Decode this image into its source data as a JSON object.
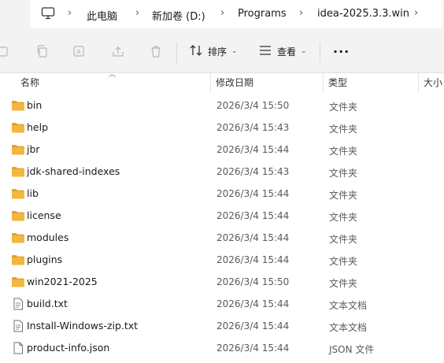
{
  "breadcrumb": [
    "此电脑",
    "新加卷 (D:)",
    "Programs",
    "idea-2025.3.3.win"
  ],
  "toolbar": {
    "sort_label": "排序",
    "view_label": "查看",
    "more_label": "···"
  },
  "columns": {
    "name": "名称",
    "date": "修改日期",
    "type": "类型",
    "size": "大小"
  },
  "files": [
    {
      "name": "bin",
      "date": "2026/3/4 15:50",
      "type": "文件夹",
      "icon": "folder-icon"
    },
    {
      "name": "help",
      "date": "2026/3/4 15:43",
      "type": "文件夹",
      "icon": "folder-icon"
    },
    {
      "name": "jbr",
      "date": "2026/3/4 15:44",
      "type": "文件夹",
      "icon": "folder-icon"
    },
    {
      "name": "jdk-shared-indexes",
      "date": "2026/3/4 15:43",
      "type": "文件夹",
      "icon": "folder-icon"
    },
    {
      "name": "lib",
      "date": "2026/3/4 15:44",
      "type": "文件夹",
      "icon": "folder-icon"
    },
    {
      "name": "license",
      "date": "2026/3/4 15:44",
      "type": "文件夹",
      "icon": "folder-icon"
    },
    {
      "name": "modules",
      "date": "2026/3/4 15:44",
      "type": "文件夹",
      "icon": "folder-icon"
    },
    {
      "name": "plugins",
      "date": "2026/3/4 15:44",
      "type": "文件夹",
      "icon": "folder-icon"
    },
    {
      "name": "win2021-2025",
      "date": "2026/3/4 15:50",
      "type": "文件夹",
      "icon": "folder-icon"
    },
    {
      "name": "build.txt",
      "date": "2026/3/4 15:44",
      "type": "文本文档",
      "icon": "text-file-icon"
    },
    {
      "name": "Install-Windows-zip.txt",
      "date": "2026/3/4 15:44",
      "type": "文本文档",
      "icon": "text-file-icon"
    },
    {
      "name": "product-info.json",
      "date": "2026/3/4 15:44",
      "type": "JSON 文件",
      "icon": "file-icon"
    }
  ],
  "colors": {
    "folder": "#f2b73c",
    "folder_dark": "#e0a22a",
    "background": "#ffffff",
    "chrome": "#f3f3f3"
  }
}
